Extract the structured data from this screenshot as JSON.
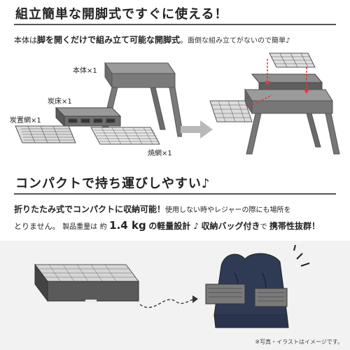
{
  "header1": {
    "title": "組立簡単な開脚式ですぐに使える！"
  },
  "intro": {
    "p1": "本体は",
    "p2": "脚を開くだけで組み立て可能な開脚式",
    "p3": "。",
    "p4": "面倒な組み立てがないので簡単♪"
  },
  "parts": {
    "body": "本体×1",
    "charcoal_bed": "炭床×1",
    "charcoal_grate": "炭置網×1",
    "grill_net": "焼網×1"
  },
  "header2": {
    "title": "コンパクトで持ち運びしやすい♪"
  },
  "compact": {
    "line1_bold": "折りたたみ式でコンパクトに収納可能！",
    "line1_small": "使用しない時やレジャーの際にも場所を",
    "line2_a": "とりません。",
    "line2_b": "製品重量は",
    "line2_c": "約",
    "line2_weight": "1.4 kg",
    "line2_d": "の軽量設計 ♪",
    "line2_e": "収納バッグ付き",
    "line2_f": "で",
    "line2_g": "携帯性抜群！"
  },
  "footer": {
    "note": "※写真・イラストはイメージです。"
  },
  "colors": {
    "metal": "#6a6a6a",
    "bag": "#2f3b55",
    "accent": "#e23b3b"
  }
}
